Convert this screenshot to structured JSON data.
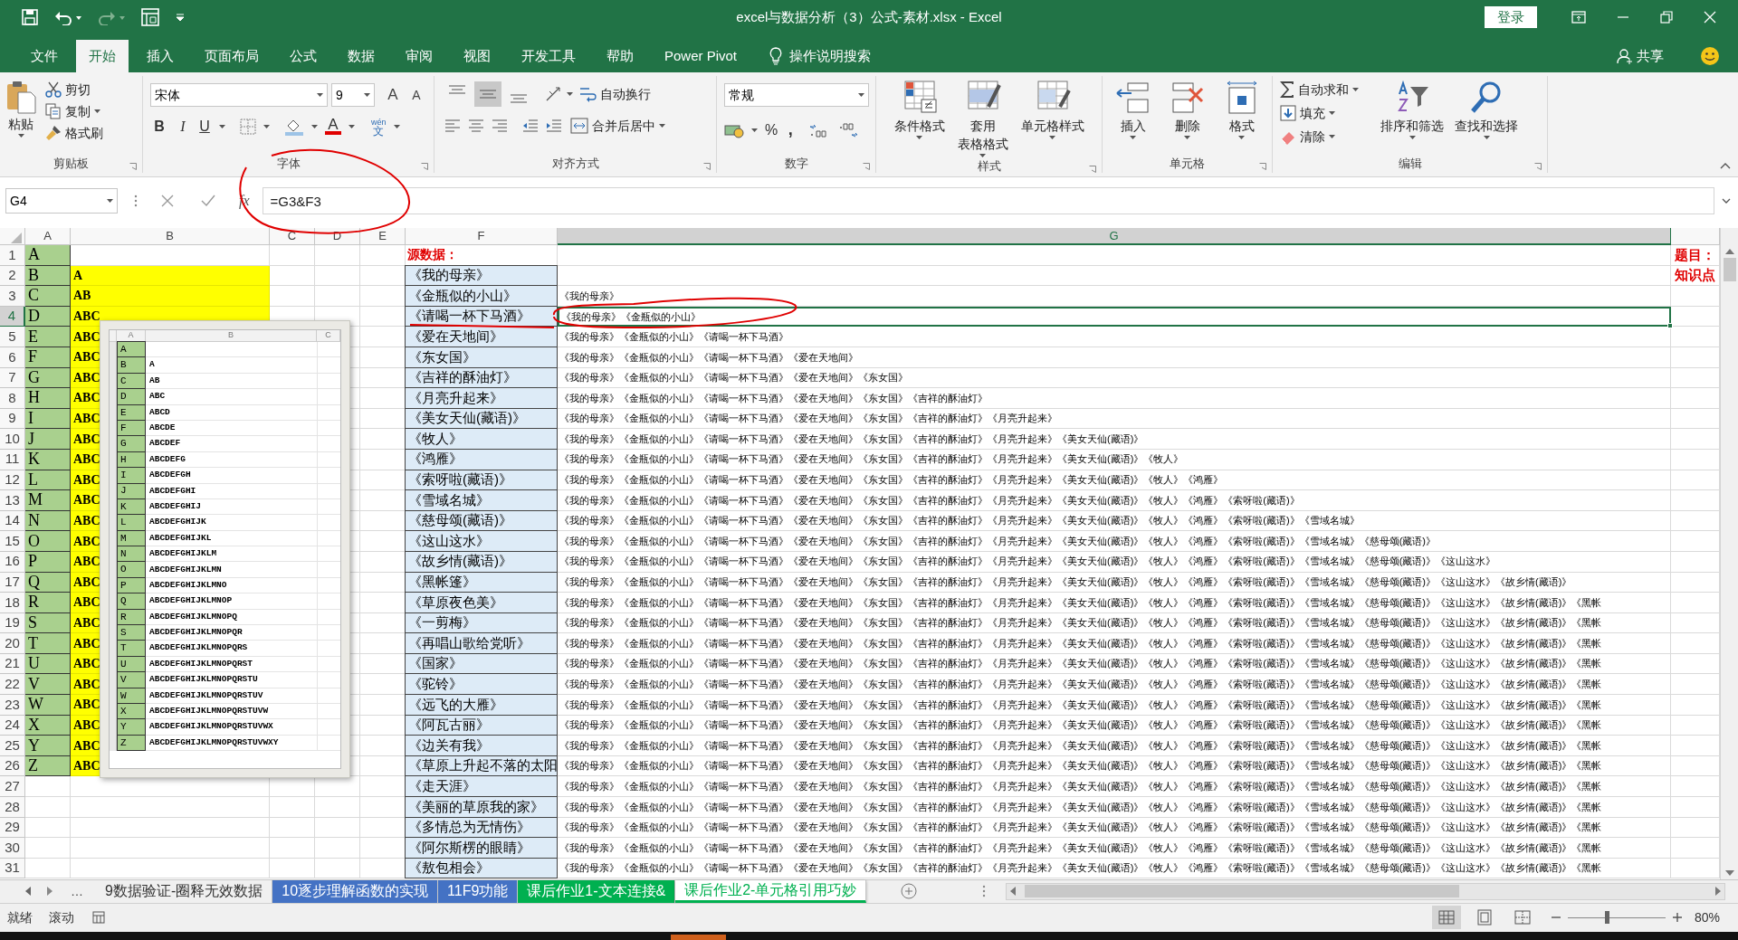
{
  "title_bar": {
    "title": "excel与数据分析（3）公式-素材.xlsx  -  Excel",
    "sign_in": "登录"
  },
  "ribbon_tabs": [
    {
      "label": "文件",
      "selected": false
    },
    {
      "label": "开始",
      "selected": true
    },
    {
      "label": "插入",
      "selected": false
    },
    {
      "label": "页面布局",
      "selected": false
    },
    {
      "label": "公式",
      "selected": false
    },
    {
      "label": "数据",
      "selected": false
    },
    {
      "label": "审阅",
      "selected": false
    },
    {
      "label": "视图",
      "selected": false
    },
    {
      "label": "开发工具",
      "selected": false
    },
    {
      "label": "帮助",
      "selected": false
    },
    {
      "label": "Power Pivot",
      "selected": false
    }
  ],
  "tell_me": "操作说明搜索",
  "share": "共享",
  "ribbon": {
    "clipboard": {
      "paste": "粘贴",
      "cut": "剪切",
      "copy": "复制",
      "format_painter": "格式刷",
      "label": "剪贴板"
    },
    "font": {
      "font_name": "宋体",
      "font_size": "9",
      "grow_font": "A",
      "shrink_font": "A",
      "bold": "B",
      "italic": "I",
      "underline": "U",
      "font_color": "A",
      "phonetic_top": "wén",
      "phonetic_bottom": "文",
      "label": "字体"
    },
    "alignment": {
      "vertical_align": [
        {
          "selected": false
        },
        {
          "selected": true
        },
        {
          "selected": false
        }
      ],
      "wrap_text": "自动换行",
      "merge_center": "合并后居中",
      "label": "对齐方式"
    },
    "number": {
      "format": "常规",
      "percent": "%",
      "comma": ",",
      "label": "数字"
    },
    "styles": {
      "conditional": "条件格式",
      "table_format_top": "套用",
      "table_format_bottom": "表格格式",
      "cell_styles": "单元格样式",
      "label": "样式"
    },
    "cells": {
      "insert": "插入",
      "delete": "删除",
      "format": "格式",
      "label": "单元格"
    },
    "editing": {
      "autosum": "自动求和",
      "fill": "填充",
      "clear": "清除",
      "sort_filter": "排序和筛选",
      "find_select": "查找和选择",
      "label": "编辑"
    }
  },
  "formula_bar": {
    "name_box": "G4",
    "function_button": "fx",
    "formula": "=G3&F3"
  },
  "columns": [
    {
      "label": "A",
      "selected": false
    },
    {
      "label": "B",
      "selected": false
    },
    {
      "label": "C",
      "selected": false
    },
    {
      "label": "D",
      "selected": false
    },
    {
      "label": "E",
      "selected": false
    },
    {
      "label": "F",
      "selected": false
    },
    {
      "label": "G",
      "selected": true
    }
  ],
  "rows": [
    {
      "number": "1",
      "a": "A",
      "f_note": "源数据：",
      "h": "题目：",
      "selected": false
    },
    {
      "number": "2",
      "a": "B",
      "b": "A",
      "f": "《我的母亲》",
      "h": "知识点",
      "selected": false
    },
    {
      "number": "3",
      "a": "C",
      "b": "AB",
      "f": "《金瓶似的小山》",
      "g": "《我的母亲》",
      "selected": false
    },
    {
      "number": "4",
      "a": "D",
      "b": "ABC",
      "f": "《请喝一杯下马酒》",
      "g": "《我的母亲》《金瓶似的小山》",
      "selected": true
    },
    {
      "number": "5",
      "a": "E",
      "b": "ABC",
      "f": "《爱在天地间》",
      "g": "《我的母亲》《金瓶似的小山》《请喝一杯下马酒》",
      "selected": false
    },
    {
      "number": "6",
      "a": "F",
      "b": "ABC",
      "f": "《东女国》",
      "g": "《我的母亲》《金瓶似的小山》《请喝一杯下马酒》《爱在天地间》",
      "selected": false
    },
    {
      "number": "7",
      "a": "G",
      "b": "ABC",
      "f": "《吉祥的酥油灯》",
      "g": "《我的母亲》《金瓶似的小山》《请喝一杯下马酒》《爱在天地间》《东女国》",
      "selected": false
    },
    {
      "number": "8",
      "a": "H",
      "b": "ABC",
      "f": "《月亮升起来》",
      "g": "《我的母亲》《金瓶似的小山》《请喝一杯下马酒》《爱在天地间》《东女国》《吉祥的酥油灯》",
      "selected": false
    },
    {
      "number": "9",
      "a": "I",
      "b": "ABC",
      "f": "《美女天仙(藏语)》",
      "g": "《我的母亲》《金瓶似的小山》《请喝一杯下马酒》《爱在天地间》《东女国》《吉祥的酥油灯》《月亮升起来》",
      "selected": false
    },
    {
      "number": "10",
      "a": "J",
      "b": "ABC",
      "f": "《牧人》",
      "g": "《我的母亲》《金瓶似的小山》《请喝一杯下马酒》《爱在天地间》《东女国》《吉祥的酥油灯》《月亮升起来》《美女天仙(藏语)》",
      "selected": false
    },
    {
      "number": "11",
      "a": "K",
      "b": "ABC",
      "f": "《鸿雁》",
      "g": "《我的母亲》《金瓶似的小山》《请喝一杯下马酒》《爱在天地间》《东女国》《吉祥的酥油灯》《月亮升起来》《美女天仙(藏语)》《牧人》",
      "selected": false
    },
    {
      "number": "12",
      "a": "L",
      "b": "ABC",
      "f": "《索呀啦(藏语)》",
      "g": "《我的母亲》《金瓶似的小山》《请喝一杯下马酒》《爱在天地间》《东女国》《吉祥的酥油灯》《月亮升起来》《美女天仙(藏语)》《牧人》《鸿雁》",
      "selected": false
    },
    {
      "number": "13",
      "a": "M",
      "b": "ABC",
      "f": "《雪域名城》",
      "g": "《我的母亲》《金瓶似的小山》《请喝一杯下马酒》《爱在天地间》《东女国》《吉祥的酥油灯》《月亮升起来》《美女天仙(藏语)》《牧人》《鸿雁》《索呀啦(藏语)》",
      "selected": false
    },
    {
      "number": "14",
      "a": "N",
      "b": "ABC",
      "f": "《慈母颂(藏语)》",
      "g": "《我的母亲》《金瓶似的小山》《请喝一杯下马酒》《爱在天地间》《东女国》《吉祥的酥油灯》《月亮升起来》《美女天仙(藏语)》《牧人》《鸿雁》《索呀啦(藏语)》《雪域名城》",
      "selected": false
    },
    {
      "number": "15",
      "a": "O",
      "b": "ABC",
      "f": "《这山这水》",
      "g": "《我的母亲》《金瓶似的小山》《请喝一杯下马酒》《爱在天地间》《东女国》《吉祥的酥油灯》《月亮升起来》《美女天仙(藏语)》《牧人》《鸿雁》《索呀啦(藏语)》《雪域名城》《慈母颂(藏语)》",
      "selected": false
    },
    {
      "number": "16",
      "a": "P",
      "b": "ABC",
      "f": "《故乡情(藏语)》",
      "g": "《我的母亲》《金瓶似的小山》《请喝一杯下马酒》《爱在天地间》《东女国》《吉祥的酥油灯》《月亮升起来》《美女天仙(藏语)》《牧人》《鸿雁》《索呀啦(藏语)》《雪域名城》《慈母颂(藏语)》《这山这水》",
      "selected": false
    },
    {
      "number": "17",
      "a": "Q",
      "b": "ABC",
      "f": "《黑帐篷》",
      "g": "《我的母亲》《金瓶似的小山》《请喝一杯下马酒》《爱在天地间》《东女国》《吉祥的酥油灯》《月亮升起来》《美女天仙(藏语)》《牧人》《鸿雁》《索呀啦(藏语)》《雪域名城》《慈母颂(藏语)》《这山这水》《故乡情(藏语)》",
      "selected": false
    },
    {
      "number": "18",
      "a": "R",
      "b": "ABC",
      "f": "《草原夜色美》",
      "g": "《我的母亲》《金瓶似的小山》《请喝一杯下马酒》《爱在天地间》《东女国》《吉祥的酥油灯》《月亮升起来》《美女天仙(藏语)》《牧人》《鸿雁》《索呀啦(藏语)》《雪域名城》《慈母颂(藏语)》《这山这水》《故乡情(藏语)》《黑帐",
      "selected": false
    },
    {
      "number": "19",
      "a": "S",
      "b": "ABC",
      "f": "《一剪梅》",
      "g": "《我的母亲》《金瓶似的小山》《请喝一杯下马酒》《爱在天地间》《东女国》《吉祥的酥油灯》《月亮升起来》《美女天仙(藏语)》《牧人》《鸿雁》《索呀啦(藏语)》《雪域名城》《慈母颂(藏语)》《这山这水》《故乡情(藏语)》《黑帐",
      "selected": false
    },
    {
      "number": "20",
      "a": "T",
      "b": "ABC",
      "f": "《再唱山歌给党听》",
      "g": "《我的母亲》《金瓶似的小山》《请喝一杯下马酒》《爱在天地间》《东女国》《吉祥的酥油灯》《月亮升起来》《美女天仙(藏语)》《牧人》《鸿雁》《索呀啦(藏语)》《雪域名城》《慈母颂(藏语)》《这山这水》《故乡情(藏语)》《黑帐",
      "selected": false
    },
    {
      "number": "21",
      "a": "U",
      "b": "ABC",
      "f": "《国家》",
      "g": "《我的母亲》《金瓶似的小山》《请喝一杯下马酒》《爱在天地间》《东女国》《吉祥的酥油灯》《月亮升起来》《美女天仙(藏语)》《牧人》《鸿雁》《索呀啦(藏语)》《雪域名城》《慈母颂(藏语)》《这山这水》《故乡情(藏语)》《黑帐",
      "selected": false
    },
    {
      "number": "22",
      "a": "V",
      "b": "ABC",
      "f": "《驼铃》",
      "g": "《我的母亲》《金瓶似的小山》《请喝一杯下马酒》《爱在天地间》《东女国》《吉祥的酥油灯》《月亮升起来》《美女天仙(藏语)》《牧人》《鸿雁》《索呀啦(藏语)》《雪域名城》《慈母颂(藏语)》《这山这水》《故乡情(藏语)》《黑帐",
      "selected": false
    },
    {
      "number": "23",
      "a": "W",
      "b": "ABC",
      "f": "《远飞的大雁》",
      "g": "《我的母亲》《金瓶似的小山》《请喝一杯下马酒》《爱在天地间》《东女国》《吉祥的酥油灯》《月亮升起来》《美女天仙(藏语)》《牧人》《鸿雁》《索呀啦(藏语)》《雪域名城》《慈母颂(藏语)》《这山这水》《故乡情(藏语)》《黑帐",
      "selected": false
    },
    {
      "number": "24",
      "a": "X",
      "b": "ABC",
      "f": "《阿瓦古丽》",
      "g": "《我的母亲》《金瓶似的小山》《请喝一杯下马酒》《爱在天地间》《东女国》《吉祥的酥油灯》《月亮升起来》《美女天仙(藏语)》《牧人》《鸿雁》《索呀啦(藏语)》《雪域名城》《慈母颂(藏语)》《这山这水》《故乡情(藏语)》《黑帐",
      "selected": false
    },
    {
      "number": "25",
      "a": "Y",
      "b": "ABC",
      "f": "《边关有我》",
      "g": "《我的母亲》《金瓶似的小山》《请喝一杯下马酒》《爱在天地间》《东女国》《吉祥的酥油灯》《月亮升起来》《美女天仙(藏语)》《牧人》《鸿雁》《索呀啦(藏语)》《雪域名城》《慈母颂(藏语)》《这山这水》《故乡情(藏语)》《黑帐",
      "selected": false
    },
    {
      "number": "26",
      "a": "Z",
      "b": "ABC",
      "f": "《草原上升起不落的太阳",
      "g": "《我的母亲》《金瓶似的小山》《请喝一杯下马酒》《爱在天地间》《东女国》《吉祥的酥油灯》《月亮升起来》《美女天仙(藏语)》《牧人》《鸿雁》《索呀啦(藏语)》《雪域名城》《慈母颂(藏语)》《这山这水》《故乡情(藏语)》《黑帐",
      "selected": false
    },
    {
      "number": "27",
      "f": "《走天涯》",
      "g": "《我的母亲》《金瓶似的小山》《请喝一杯下马酒》《爱在天地间》《东女国》《吉祥的酥油灯》《月亮升起来》《美女天仙(藏语)》《牧人》《鸿雁》《索呀啦(藏语)》《雪域名城》《慈母颂(藏语)》《这山这水》《故乡情(藏语)》《黑帐",
      "selected": false
    },
    {
      "number": "28",
      "f": "《美丽的草原我的家》",
      "g": "《我的母亲》《金瓶似的小山》《请喝一杯下马酒》《爱在天地间》《东女国》《吉祥的酥油灯》《月亮升起来》《美女天仙(藏语)》《牧人》《鸿雁》《索呀啦(藏语)》《雪域名城》《慈母颂(藏语)》《这山这水》《故乡情(藏语)》《黑帐",
      "selected": false
    },
    {
      "number": "29",
      "f": "《多情总为无情伤》",
      "g": "《我的母亲》《金瓶似的小山》《请喝一杯下马酒》《爱在天地间》《东女国》《吉祥的酥油灯》《月亮升起来》《美女天仙(藏语)》《牧人》《鸿雁》《索呀啦(藏语)》《雪域名城》《慈母颂(藏语)》《这山这水》《故乡情(藏语)》《黑帐",
      "selected": false
    },
    {
      "number": "30",
      "f": "《阿尔斯楞的眼睛》",
      "g": "《我的母亲》《金瓶似的小山》《请喝一杯下马酒》《爱在天地间》《东女国》《吉祥的酥油灯》《月亮升起来》《美女天仙(藏语)》《牧人》《鸿雁》《索呀啦(藏语)》《雪域名城》《慈母颂(藏语)》《这山这水》《故乡情(藏语)》《黑帐",
      "selected": false
    },
    {
      "number": "31",
      "f": "《敖包相会》",
      "g": "《我的母亲》《金瓶似的小山》《请喝一杯下马酒》《爱在天地间》《东女国》《吉祥的酥油灯》《月亮升起来》《美女天仙(藏语)》《牧人》《鸿雁》《索呀啦(藏语)》《雪域名城》《慈母颂(藏语)》《这山这水》《故乡情(藏语)》《黑帐",
      "selected": false
    }
  ],
  "inset_screenshot": {
    "columns": [
      "A",
      "B",
      "C"
    ],
    "rows": [
      {
        "a": "A"
      },
      {
        "a": "B",
        "b": "A"
      },
      {
        "a": "C",
        "b": "AB"
      },
      {
        "a": "D",
        "b": "ABC"
      },
      {
        "a": "E",
        "b": "ABCD"
      },
      {
        "a": "F",
        "b": "ABCDE"
      },
      {
        "a": "G",
        "b": "ABCDEF"
      },
      {
        "a": "H",
        "b": "ABCDEFG"
      },
      {
        "a": "I",
        "b": "ABCDEFGH"
      },
      {
        "a": "J",
        "b": "ABCDEFGHI"
      },
      {
        "a": "K",
        "b": "ABCDEFGHIJ"
      },
      {
        "a": "L",
        "b": "ABCDEFGHIJK"
      },
      {
        "a": "M",
        "b": "ABCDEFGHIJKL"
      },
      {
        "a": "N",
        "b": "ABCDEFGHIJKLM"
      },
      {
        "a": "O",
        "b": "ABCDEFGHIJKLMN"
      },
      {
        "a": "P",
        "b": "ABCDEFGHIJKLMNO"
      },
      {
        "a": "Q",
        "b": "ABCDEFGHIJKLMNOP"
      },
      {
        "a": "R",
        "b": "ABCDEFGHIJKLMNOPQ"
      },
      {
        "a": "S",
        "b": "ABCDEFGHIJKLMNOPQR"
      },
      {
        "a": "T",
        "b": "ABCDEFGHIJKLMNOPQRS"
      },
      {
        "a": "U",
        "b": "ABCDEFGHIJKLMNOPQRST"
      },
      {
        "a": "V",
        "b": "ABCDEFGHIJKLMNOPQRSTU"
      },
      {
        "a": "W",
        "b": "ABCDEFGHIJKLMNOPQRSTUV"
      },
      {
        "a": "X",
        "b": "ABCDEFGHIJKLMNOPQRSTUVW"
      },
      {
        "a": "Y",
        "b": "ABCDEFGHIJKLMNOPQRSTUVWX"
      },
      {
        "a": "Z",
        "b": "ABCDEFGHIJKLMNOPQRSTUVWXY"
      }
    ]
  },
  "sheet_tabs": [
    {
      "label": "9数据验证-圈释无效数据",
      "selected": false
    },
    {
      "label": "10逐步理解函数的实现",
      "color": "#4472c4",
      "selected": false
    },
    {
      "label": "11F9功能",
      "color": "#4472c4",
      "selected": false
    },
    {
      "label": "课后作业1-文本连接&",
      "color": "#00b050",
      "selected": false
    },
    {
      "label": "课后作业2-单元格引用巧妙",
      "color": "#00b050",
      "selected": true
    }
  ],
  "sheet_nav_more": "…",
  "status_bar": {
    "ready": "就绪",
    "scroll_lock": "滚动",
    "view_modes": [
      {
        "selected": true
      },
      {
        "selected": false
      },
      {
        "selected": false
      }
    ],
    "zoom": {
      "level": 0.4,
      "text": "80%"
    }
  }
}
